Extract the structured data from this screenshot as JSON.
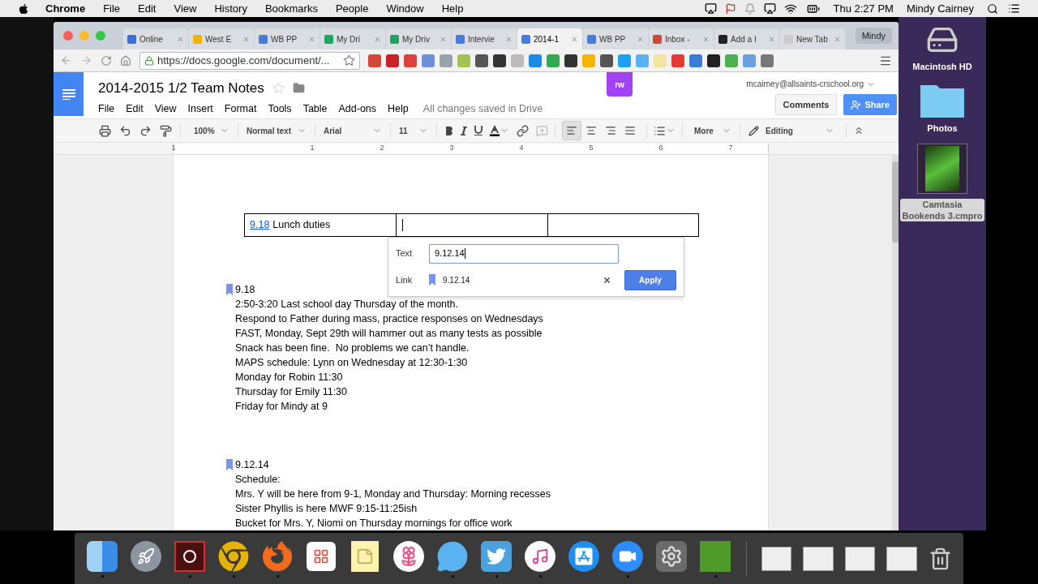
{
  "menubar": {
    "app": "Chrome",
    "menus": [
      "File",
      "Edit",
      "View",
      "History",
      "Bookmarks",
      "People",
      "Window",
      "Help"
    ],
    "clock": "Thu 2:27 PM",
    "user": "Mindy Cairney"
  },
  "browser": {
    "tabs": [
      {
        "title": "Online",
        "selected": false
      },
      {
        "title": "West E",
        "selected": false
      },
      {
        "title": "WB PP",
        "selected": false
      },
      {
        "title": "My Dri",
        "selected": false
      },
      {
        "title": "My Driv",
        "selected": false
      },
      {
        "title": "Intervie",
        "selected": false
      },
      {
        "title": "2014-1",
        "selected": true
      },
      {
        "title": "WB PP",
        "selected": false
      },
      {
        "title": "Inbox -",
        "selected": false
      },
      {
        "title": "Add a I",
        "selected": false
      },
      {
        "title": "New Tab",
        "selected": false
      }
    ],
    "profile": "Mindy",
    "url": "https://docs.google.com/document/...",
    "extension_badge": "rw"
  },
  "document": {
    "title": "2014-2015 1/2 Team Notes",
    "starred": false,
    "menus": [
      "File",
      "Edit",
      "View",
      "Insert",
      "Format",
      "Tools",
      "Table",
      "Add-ons",
      "Help"
    ],
    "save_status": "All changes saved in Drive",
    "account": "mcairney@allsaints-crschool.org",
    "comments": "Comments",
    "share": "Share"
  },
  "toolbar": {
    "zoom": "100%",
    "style": "Normal text",
    "font": "Arial",
    "size": "11",
    "more": "More",
    "mode": "Editing",
    "alignments": [
      {
        "selected": true
      },
      {
        "selected": false
      },
      {
        "selected": false
      },
      {
        "selected": false
      }
    ]
  },
  "ruler": [
    "1",
    "1",
    "2",
    "3",
    "4",
    "5",
    "6",
    "7"
  ],
  "table": {
    "link": "9.18",
    "text": "Lunch duties"
  },
  "link_popup": {
    "text_label": "Text",
    "text_value": "9.12.14",
    "link_label": "Link",
    "link_value": "9.12.14",
    "apply": "Apply"
  },
  "sections": [
    {
      "heading": "9.18",
      "lines": [
        "2:50-3:20 Last school day Thursday of the month.",
        "Respond to Father during mass, practice responses on Wednesdays",
        "FAST, Monday, Sept 29th will hammer out as many tests as possible",
        "Snack has been fine.  No problems we can’t handle.",
        "MAPS schedule: Lynn on Wednesday at 12:30-1:30",
        "Monday for Robin 11:30",
        "Thursday for Emily 11:30",
        "Friday for Mindy at 9"
      ]
    },
    {
      "heading": "9.12.14",
      "lines": [
        "Schedule:",
        "Mrs. Y will be here from 9-1, Monday and Thursday: Morning recesses",
        "Sister Phyllis is here MWF 9:15-11:25ish",
        "Bucket for Mrs. Y, Niomi on Thursday mornings for office work"
      ]
    }
  ],
  "desktop": [
    {
      "kind": "disk",
      "label": [
        "Macintosh HD"
      ]
    },
    {
      "kind": "folder",
      "label": [
        "Photos"
      ]
    },
    {
      "kind": "file",
      "label": [
        "Camtasia",
        "Bookends 3.cmpro"
      ]
    }
  ],
  "dock": [
    {
      "running": true
    },
    {
      "running": false
    },
    {
      "running": true
    },
    {
      "running": true
    },
    {
      "running": true
    },
    {
      "running": false
    },
    {
      "running": false
    },
    {
      "running": false
    },
    {
      "running": true
    },
    {
      "running": true
    },
    {
      "running": true
    },
    {
      "running": false
    },
    {
      "running": true
    },
    {
      "running": false
    },
    {
      "running": true
    }
  ]
}
